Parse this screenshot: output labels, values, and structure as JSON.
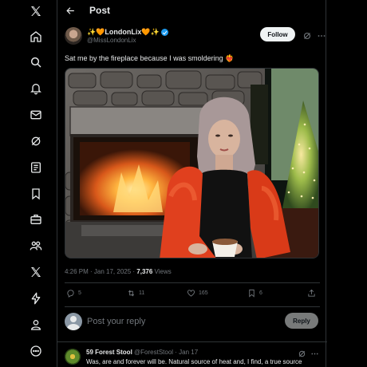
{
  "header": {
    "title": "Post"
  },
  "nav": {
    "items": [
      {
        "icon": "x-logo-icon"
      },
      {
        "icon": "home-icon"
      },
      {
        "icon": "search-icon"
      },
      {
        "icon": "notifications-icon"
      },
      {
        "icon": "messages-icon"
      },
      {
        "icon": "grok-icon"
      },
      {
        "icon": "lists-icon"
      },
      {
        "icon": "bookmarks-icon"
      },
      {
        "icon": "jobs-icon"
      },
      {
        "icon": "communities-icon"
      },
      {
        "icon": "premium-icon"
      },
      {
        "icon": "verified-orgs-icon"
      },
      {
        "icon": "profile-icon"
      },
      {
        "icon": "more-icon"
      }
    ]
  },
  "post": {
    "author_name": "✨🧡LondonLix🧡✨",
    "author_handle": "@MissLondonLix",
    "follow_label": "Follow",
    "text": "Sat me by the fireplace because I was smoldering ❤️‍🔥",
    "time": "4:26 PM · Jan 17, 2025 · ",
    "views_count": "7,376",
    "views_label": " Views",
    "stats": {
      "replies": "5",
      "reposts": "11",
      "likes": "165",
      "bookmarks": "6"
    }
  },
  "reply": {
    "placeholder": "Post your reply",
    "button_label": "Reply"
  },
  "comment": {
    "name": "59 Forest Stool",
    "handle": "@ForestStool",
    "date": " · Jan 17",
    "text": "Was, are and forever will be. Natural source of heat and, I find, a true source"
  },
  "colors": {
    "background": "#000000",
    "border": "#2f3336",
    "text_primary": "#e7e9ea",
    "text_secondary": "#71767b",
    "verified_blue": "#1d9bf0"
  }
}
